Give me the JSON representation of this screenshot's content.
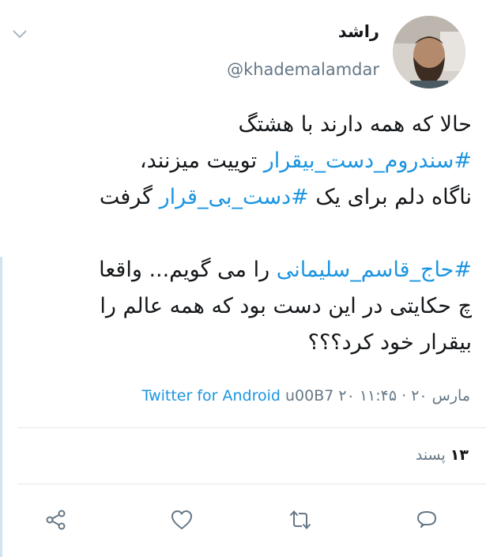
{
  "tweet": {
    "display_name": "راشد",
    "handle": "@khademalamdar",
    "lines": [
      [
        {
          "t": "حالا که همه دارند با هشتگ",
          "h": false
        }
      ],
      [
        {
          "t": "#سندروم_دست_بیقرار",
          "h": true
        },
        {
          "t": " توییت میزنند،",
          "h": false
        }
      ],
      [
        {
          "t": "ناگاه دلم برای یک ",
          "h": false
        },
        {
          "t": "#دست_بی_قرار",
          "h": true
        },
        {
          "t": " گرفت",
          "h": false
        }
      ],
      [],
      [
        {
          "t": "#حاج_قاسم_سلیمانی",
          "h": true
        },
        {
          "t": " را می گویم... واقعا",
          "h": false
        }
      ],
      [
        {
          "t": "چ حکایتی در این دست بود که همه عالم را",
          "h": false
        }
      ],
      [
        {
          "t": "بیقرار خود کرد؟؟؟",
          "h": false
        }
      ]
    ],
    "meta": {
      "source": "Twitter for Android",
      "rest": " u00B7 ۲۰ مارس ۲۰ · ۱۱:۴۵"
    },
    "likes": {
      "count": "۱۳",
      "label": "پسند"
    }
  },
  "icons": {
    "menu": "chevron-down-icon",
    "reply": "reply-icon",
    "retweet": "retweet-icon",
    "like": "heart-icon",
    "share": "share-icon"
  },
  "colors": {
    "accent": "#1b95e0",
    "muted": "#657786",
    "text": "#14171a"
  }
}
